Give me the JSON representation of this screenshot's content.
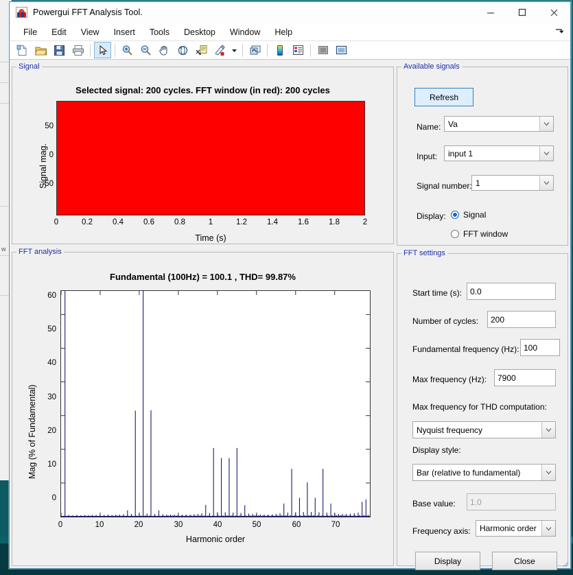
{
  "window": {
    "title": "Powergui FFT Analysis Tool.",
    "app_icon": "matlab-icon",
    "minimize": "minimize-icon",
    "maximize": "maximize-icon",
    "close": "close-icon"
  },
  "menu": {
    "items": [
      "File",
      "Edit",
      "View",
      "Insert",
      "Tools",
      "Desktop",
      "Window",
      "Help"
    ],
    "overflow_icon": "menu-overflow-arrow-icon"
  },
  "toolbar": {
    "buttons": [
      {
        "name": "new-figure-icon",
        "group": 0
      },
      {
        "name": "open-file-icon",
        "group": 0
      },
      {
        "name": "save-figure-icon",
        "group": 0
      },
      {
        "name": "print-figure-icon",
        "group": 0
      },
      {
        "name": "pointer-select-icon",
        "group": 1,
        "selected": true
      },
      {
        "name": "zoom-in-icon",
        "group": 2
      },
      {
        "name": "zoom-out-icon",
        "group": 2
      },
      {
        "name": "pan-hand-icon",
        "group": 2
      },
      {
        "name": "rotate-3d-icon",
        "group": 2
      },
      {
        "name": "data-cursor-icon",
        "group": 2
      },
      {
        "name": "brush-data-icon",
        "group": 2
      },
      {
        "name": "brush-dropdown-arrow-icon",
        "group": 2
      },
      {
        "name": "link-data-icon",
        "group": 3
      },
      {
        "name": "colorbar-icon",
        "group": 4
      },
      {
        "name": "legend-icon",
        "group": 4
      },
      {
        "name": "hide-plot-tools-icon",
        "group": 5
      },
      {
        "name": "show-plot-tools-icon",
        "group": 5
      }
    ]
  },
  "signal_panel": {
    "legend": "Signal"
  },
  "fft_panel": {
    "legend": "FFT analysis"
  },
  "available_signals": {
    "legend": "Available signals",
    "refresh_label": "Refresh",
    "name_label": "Name:",
    "name_value": "Va",
    "input_label": "Input:",
    "input_value": "input 1",
    "signal_number_label": "Signal number:",
    "signal_number_value": "1",
    "display_label": "Display:",
    "radio_signal": "Signal",
    "radio_fft_window": "FFT window",
    "selected_display": "Signal"
  },
  "fft_settings": {
    "legend": "FFT settings",
    "start_time_label": "Start time (s):",
    "start_time_value": "0.0",
    "cycles_label": "Number of cycles:",
    "cycles_value": "200",
    "fundamental_label": "Fundamental frequency (Hz):",
    "fundamental_value": "100",
    "max_freq_label": "Max frequency (Hz):",
    "max_freq_value": "7900",
    "max_freq_thd_label": "Max frequency for THD computation:",
    "max_freq_thd_value": "Nyquist frequency",
    "display_style_label": "Display style:",
    "display_style_value": "Bar (relative to fundamental)",
    "base_value_label": "Base value:",
    "base_value_value": "1.0",
    "freq_axis_label": "Frequency axis:",
    "freq_axis_value": "Harmonic order",
    "display_button": "Display",
    "close_button": "Close"
  },
  "chart_data": [
    {
      "type": "area",
      "id": "signal-plot",
      "title": "Selected signal: 200 cycles. FFT window (in red): 200 cycles",
      "xlabel": "Time (s)",
      "ylabel": "Signal mag.",
      "xlim": [
        0,
        2
      ],
      "ylim": [
        -100,
        100
      ],
      "xticks": [
        0,
        0.2,
        0.4,
        0.6,
        0.8,
        1,
        1.2,
        1.4,
        1.6,
        1.8,
        2
      ],
      "xticklabels": [
        "0",
        "0.2",
        "0.4",
        "0.6",
        "0.8",
        "1",
        "1.2",
        "1.4",
        "1.6",
        "1.8",
        "2"
      ],
      "yticks": [
        -50,
        0,
        50
      ],
      "yticklabels": [
        "-50",
        "0",
        "50"
      ],
      "grid": false,
      "fill_color": "#ff0000",
      "note": "FFT window shown solid red across full 0..2 s span, magnitude saturating the +/-100 axis"
    },
    {
      "type": "bar",
      "id": "fft-spectrum",
      "title": "Fundamental (100Hz) = 100.1 , THD= 99.87%",
      "xlabel": "Harmonic order",
      "ylabel": "Mag (% of Fundamental)",
      "xlim": [
        0,
        79
      ],
      "ylim": [
        0,
        67
      ],
      "xticks": [
        0,
        10,
        20,
        30,
        40,
        50,
        60,
        70
      ],
      "xticklabels": [
        "0",
        "10",
        "20",
        "30",
        "40",
        "50",
        "60",
        "70"
      ],
      "yticks": [
        0,
        10,
        20,
        30,
        40,
        50,
        60
      ],
      "yticklabels": [
        "0",
        "10",
        "20",
        "30",
        "40",
        "50",
        "60"
      ],
      "grid": false,
      "bar_color": "#1a1a6e",
      "categories": [
        0,
        1,
        2,
        3,
        4,
        5,
        6,
        7,
        8,
        9,
        10,
        11,
        12,
        13,
        14,
        15,
        16,
        17,
        18,
        19,
        20,
        21,
        22,
        23,
        24,
        25,
        26,
        27,
        28,
        29,
        30,
        31,
        32,
        33,
        34,
        35,
        36,
        37,
        38,
        39,
        40,
        41,
        42,
        43,
        44,
        45,
        46,
        47,
        48,
        49,
        50,
        51,
        52,
        53,
        54,
        55,
        56,
        57,
        58,
        59,
        60,
        61,
        62,
        63,
        64,
        65,
        66,
        67,
        68,
        69,
        70,
        71,
        72,
        73,
        74,
        75,
        76,
        77,
        78
      ],
      "values": [
        0.4,
        67,
        0.5,
        0.4,
        0.5,
        0.4,
        0.5,
        0.4,
        0.5,
        0.5,
        0.6,
        0.5,
        0.6,
        0.5,
        0.6,
        0.6,
        0.7,
        1.9,
        0.8,
        31.5,
        0.9,
        67,
        0.9,
        31.6,
        0.8,
        1.9,
        0.7,
        0.6,
        0.6,
        0.6,
        0.6,
        0.6,
        0.6,
        0.6,
        0.7,
        0.8,
        1.0,
        3.5,
        1.1,
        20.4,
        1.3,
        17.4,
        1.3,
        17.4,
        1.2,
        20.4,
        1.1,
        3.4,
        0.9,
        0.8,
        0.7,
        0.6,
        0.6,
        0.6,
        0.7,
        0.8,
        1.0,
        3.9,
        1.2,
        14.2,
        1.3,
        5.6,
        1.4,
        10.2,
        1.4,
        5.6,
        1.3,
        14.2,
        1.2,
        3.9,
        1.0,
        0.8,
        0.8,
        0.8,
        0.9,
        1.0,
        1.2,
        4.4,
        5.1
      ]
    }
  ]
}
